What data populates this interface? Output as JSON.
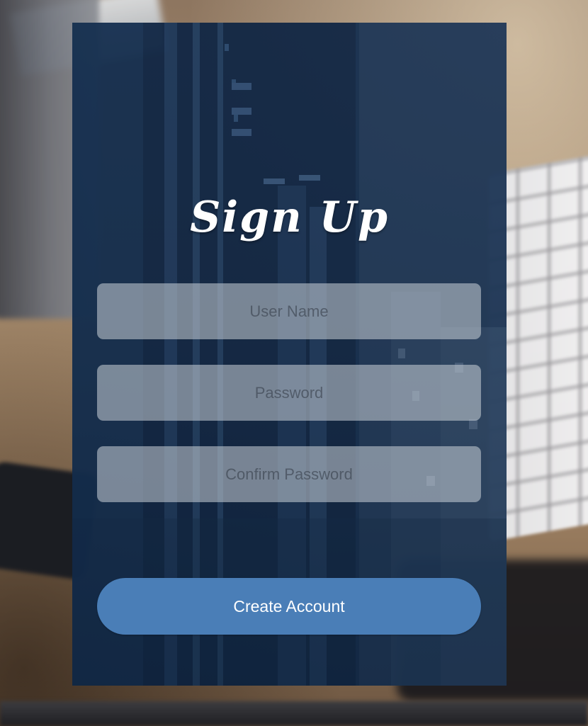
{
  "signup": {
    "title": "Sign Up",
    "fields": {
      "username": {
        "placeholder": "User Name",
        "value": ""
      },
      "password": {
        "placeholder": "Password",
        "value": ""
      },
      "confirm_password": {
        "placeholder": "Confirm Password",
        "value": ""
      }
    },
    "submit_label": "Create Account"
  },
  "colors": {
    "card_overlay": "#142b4a",
    "button": "#4a7eb7",
    "field_fill": "#c8ced6",
    "title_text": "#ffffff"
  }
}
